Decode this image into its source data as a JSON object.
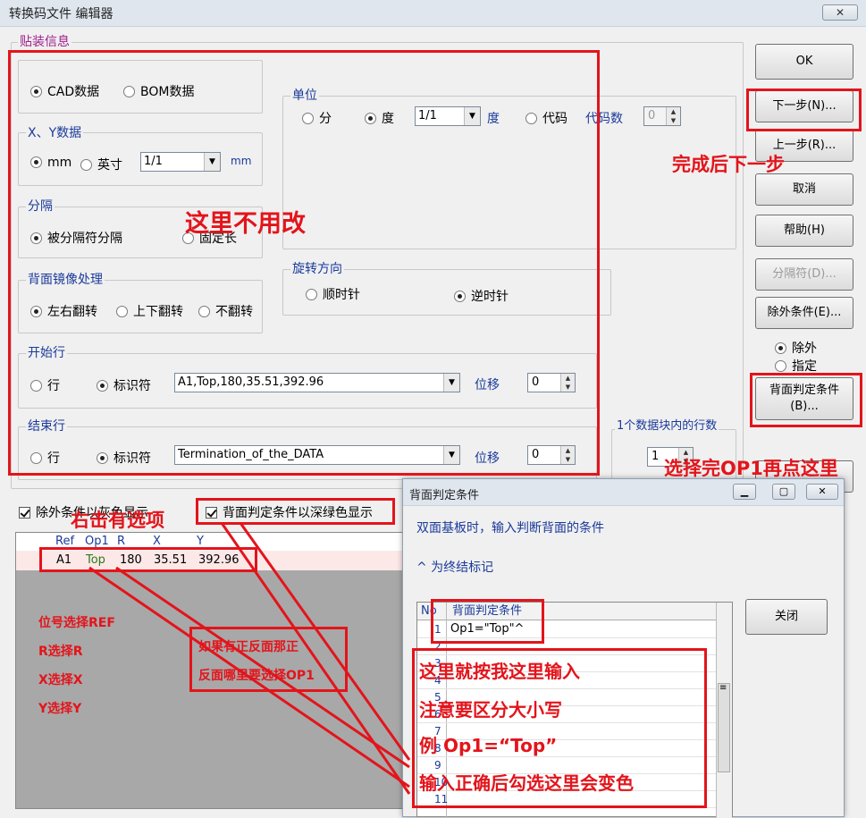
{
  "window": {
    "title": "转换码文件 编辑器",
    "close_glyph": "✕"
  },
  "placement": {
    "legend": "贴装信息"
  },
  "data_source": {
    "cad": "CAD数据",
    "bom": "BOM数据",
    "selected": "cad"
  },
  "xy": {
    "legend": "X、Y数据",
    "mm": "mm",
    "inch": "英寸",
    "ratio": "1/1",
    "unit": "mm",
    "selected": "mm"
  },
  "unit_group": {
    "legend": "单位",
    "fen": "分",
    "degree": "度",
    "ratio": "1/1",
    "degree_suffix": "度",
    "code": "代码",
    "code_count_label": "代码数",
    "code_count_value": "0",
    "selected": "degree"
  },
  "separator": {
    "legend": "分隔",
    "by_sep": "被分隔符分隔",
    "fixed": "固定长",
    "selected": "by_sep"
  },
  "mirror": {
    "legend": "背面镜像处理",
    "lr": "左右翻转",
    "ud": "上下翻转",
    "none": "不翻转",
    "selected": "lr"
  },
  "rotation": {
    "legend": "旋转方向",
    "cw": "顺时针",
    "ccw": "逆时针",
    "selected": "ccw"
  },
  "start_row": {
    "legend": "开始行",
    "row": "行",
    "marker": "标识符",
    "value": "A1,Top,180,35.51,392.96",
    "offset_label": "位移",
    "offset_value": "0",
    "selected": "marker"
  },
  "end_row": {
    "legend": "结束行",
    "row": "行",
    "marker": "标识符",
    "value": "Termination_of_the_DATA",
    "offset_label": "位移",
    "offset_value": "0",
    "selected": "marker"
  },
  "block_lines": {
    "legend": "1个数据块内的行数",
    "value": "1"
  },
  "buttons": {
    "ok": "OK",
    "next": "下一步(N)...",
    "prev": "上一步(R)...",
    "cancel": "取消",
    "help": "帮助(H)",
    "sep": "分隔符(D)...",
    "exclude_cond": "除外条件(E)...",
    "back_cond": "背面判定条件\n(B)..."
  },
  "exclude_mode": {
    "exclude": "除外",
    "specify": "指定",
    "selected": "exclude"
  },
  "checks": {
    "exclude_gray": "除外条件以灰色显示",
    "back_green": "背面判定条件以深绿色显示"
  },
  "grid": {
    "headers": [
      "Ref",
      "Op1",
      "R",
      "X",
      "Y"
    ],
    "row": [
      "A1",
      "Top",
      "180",
      "35.51",
      "392.96"
    ]
  },
  "popup": {
    "title": "背面判定条件",
    "desc": "双面基板时，输入判断背面的条件",
    "hint": "^ 为终结标记",
    "col_no": "No",
    "col_cond": "背面判定条件",
    "rows": [
      "1",
      "2",
      "3",
      "4",
      "5",
      "6",
      "7",
      "8",
      "9",
      "10",
      "11"
    ],
    "first_value": "Op1=\"Top\"^",
    "close": "关闭"
  },
  "annotations": {
    "no_change": "这里不用改",
    "finish_next": "完成后下一步",
    "after_op1": "选择完OP1再点这里",
    "right_click": "右击有选项",
    "mapping": [
      "位号选择REF",
      "R选择R",
      "X选择X",
      "Y选择Y"
    ],
    "side_note": [
      "如果有正反面那正",
      "反面哪里要选择OP1"
    ],
    "input_note": [
      "这里就按我这里输入",
      "注意要区分大小写",
      "例 Op1=“Top”",
      "输入正确后勾选这里会变色"
    ]
  },
  "colors": {
    "annotation_red": "#e3141b",
    "legend_blue": "#1a3a9a",
    "legend_purple": "#a0208a",
    "top_green": "#2a7a1a"
  }
}
